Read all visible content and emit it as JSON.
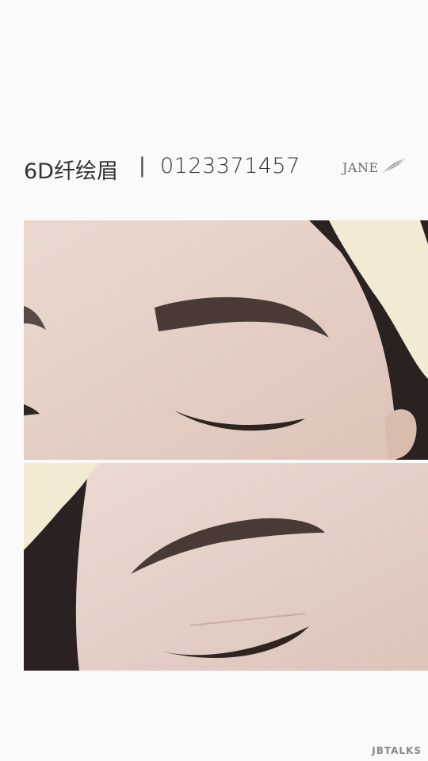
{
  "header": {
    "title": "6D纤绘眉",
    "separator": "|",
    "phone": "0123371457",
    "brand": "JANE"
  },
  "photos": {
    "top_label": "brow-photo-closeup-1",
    "bottom_label": "brow-photo-closeup-2"
  },
  "watermark": "JBTALKS",
  "colors": {
    "background": "#fafafa",
    "skin": "#e9d8d0",
    "brow": "#4a3a35",
    "hair": "#2a2220",
    "headband": "#f2ead2"
  },
  "icons": {
    "brand_mark": "feather-icon"
  }
}
